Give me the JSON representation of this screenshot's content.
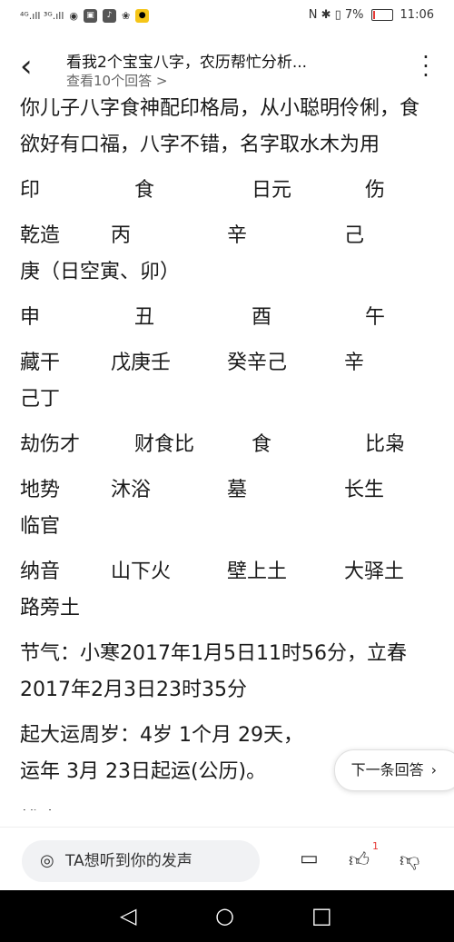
{
  "status_bar": {
    "left_signal": "⁴ᴳ.ıll ³ᴳ.ıll",
    "right_items": "N ✱ ▯ 7%",
    "battery_percent": 7,
    "time": "11:06"
  },
  "header": {
    "title": "看我2个宝宝八字，农历帮忙分析...",
    "subtitle": "查看10个回答 >"
  },
  "content": {
    "intro": "你儿子八字食神配印格局，从小聪明伶俐，食欲好有口福，八字不错，名字取水木为用",
    "row1": [
      "印",
      "食",
      "日元",
      "伤"
    ],
    "row2": [
      "乾造",
      "丙",
      "辛",
      "己"
    ],
    "row2b": "庚（日空寅、卯）",
    "row3": [
      "申",
      "丑",
      "酉",
      "午"
    ],
    "row4": [
      "藏干",
      "戊庚壬",
      "癸辛己",
      "辛"
    ],
    "row4b": "己丁",
    "row5": [
      "劫伤才",
      "财食比",
      "食",
      "比枭"
    ],
    "row6": [
      "地势",
      "沐浴",
      "墓",
      "长生"
    ],
    "row6b": "临官",
    "row7": [
      "纳音",
      "山下火",
      "壁上土",
      "大驿土"
    ],
    "row7b": "路旁土",
    "jieqi": "节气：小寒2017年1月5日11时56分，立春2017年2月3日23时35分",
    "qiyun": "起大运周岁：4岁 1个月 29天，",
    "qiyun2": "运年 3月 23日起运(公历)。",
    "cut_line": "排大运"
  },
  "next_answer": {
    "label": "下一条回答",
    "icon": "chevron-right-icon"
  },
  "action_bar": {
    "comment_placeholder": "TA想听到你的发声",
    "like_count": "1"
  }
}
